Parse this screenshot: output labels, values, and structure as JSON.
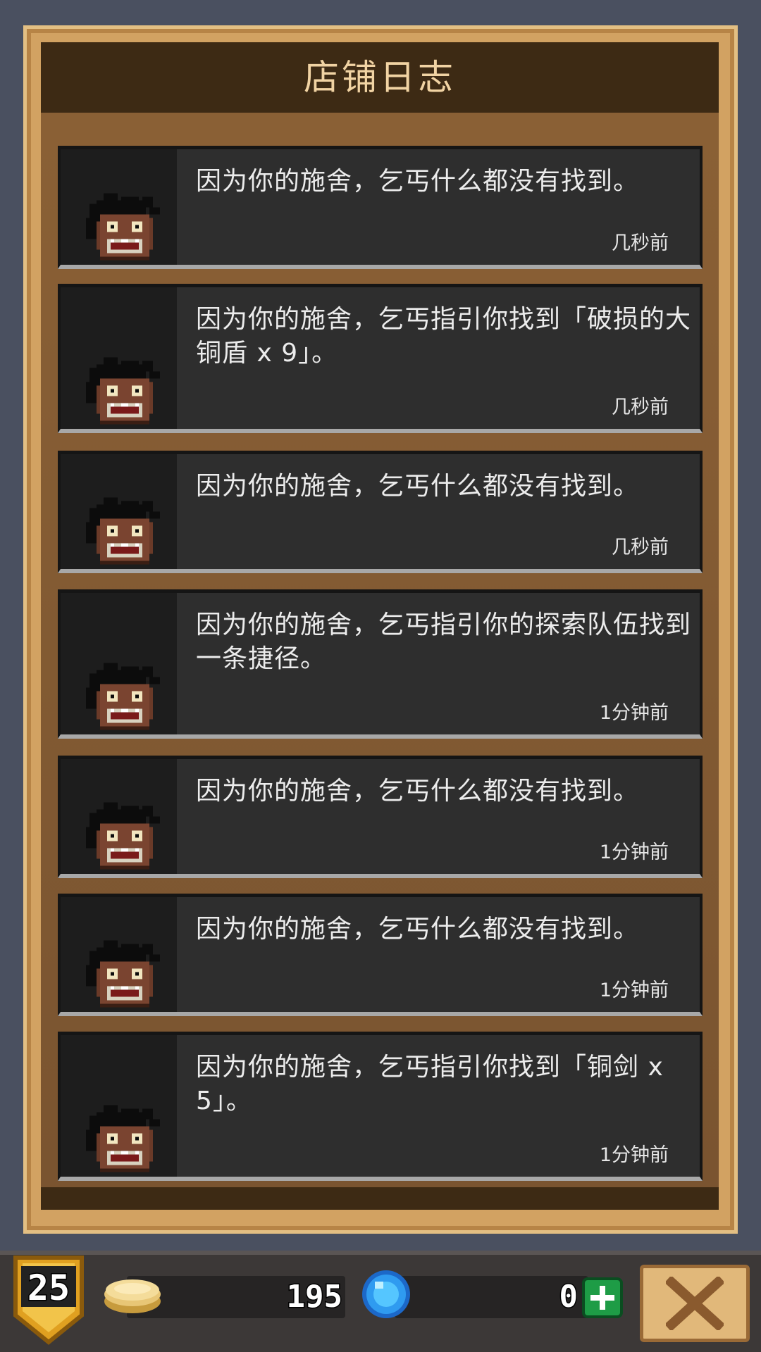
{
  "header": {
    "title": "店铺日志"
  },
  "log_entries": [
    {
      "text": "因为你的施舍，乞丐什么都没有找到。",
      "time": "几秒前"
    },
    {
      "text": "因为你的施舍，乞丐指引你找到「破损的大铜盾 x 9」。",
      "time": "几秒前"
    },
    {
      "text": "因为你的施舍，乞丐什么都没有找到。",
      "time": "几秒前"
    },
    {
      "text": "因为你的施舍，乞丐指引你的探索队伍找到一条捷径。",
      "time": "1分钟前"
    },
    {
      "text": "因为你的施舍，乞丐什么都没有找到。",
      "time": "1分钟前"
    },
    {
      "text": "因为你的施舍，乞丐什么都没有找到。",
      "time": "1分钟前"
    },
    {
      "text": "因为你的施舍，乞丐指引你找到「铜剑 x 5」。",
      "time": "1分钟前"
    }
  ],
  "footer": {
    "level": "25",
    "gold": "195",
    "gems": "0"
  },
  "icons": {
    "avatar": "beggar-icon",
    "gold": "gold-coin-icon",
    "gem": "blue-gem-icon",
    "add": "plus-icon",
    "close": "close-icon"
  },
  "colors": {
    "background": "#4a5060",
    "panel_frame": "#d2a262",
    "panel_wood": "#835a31",
    "title_bar": "#3d2a14",
    "title_text": "#f1d3a3",
    "card": "#2e2e2e",
    "add_button": "#1e9c46",
    "close_button": "#e1b87a"
  }
}
